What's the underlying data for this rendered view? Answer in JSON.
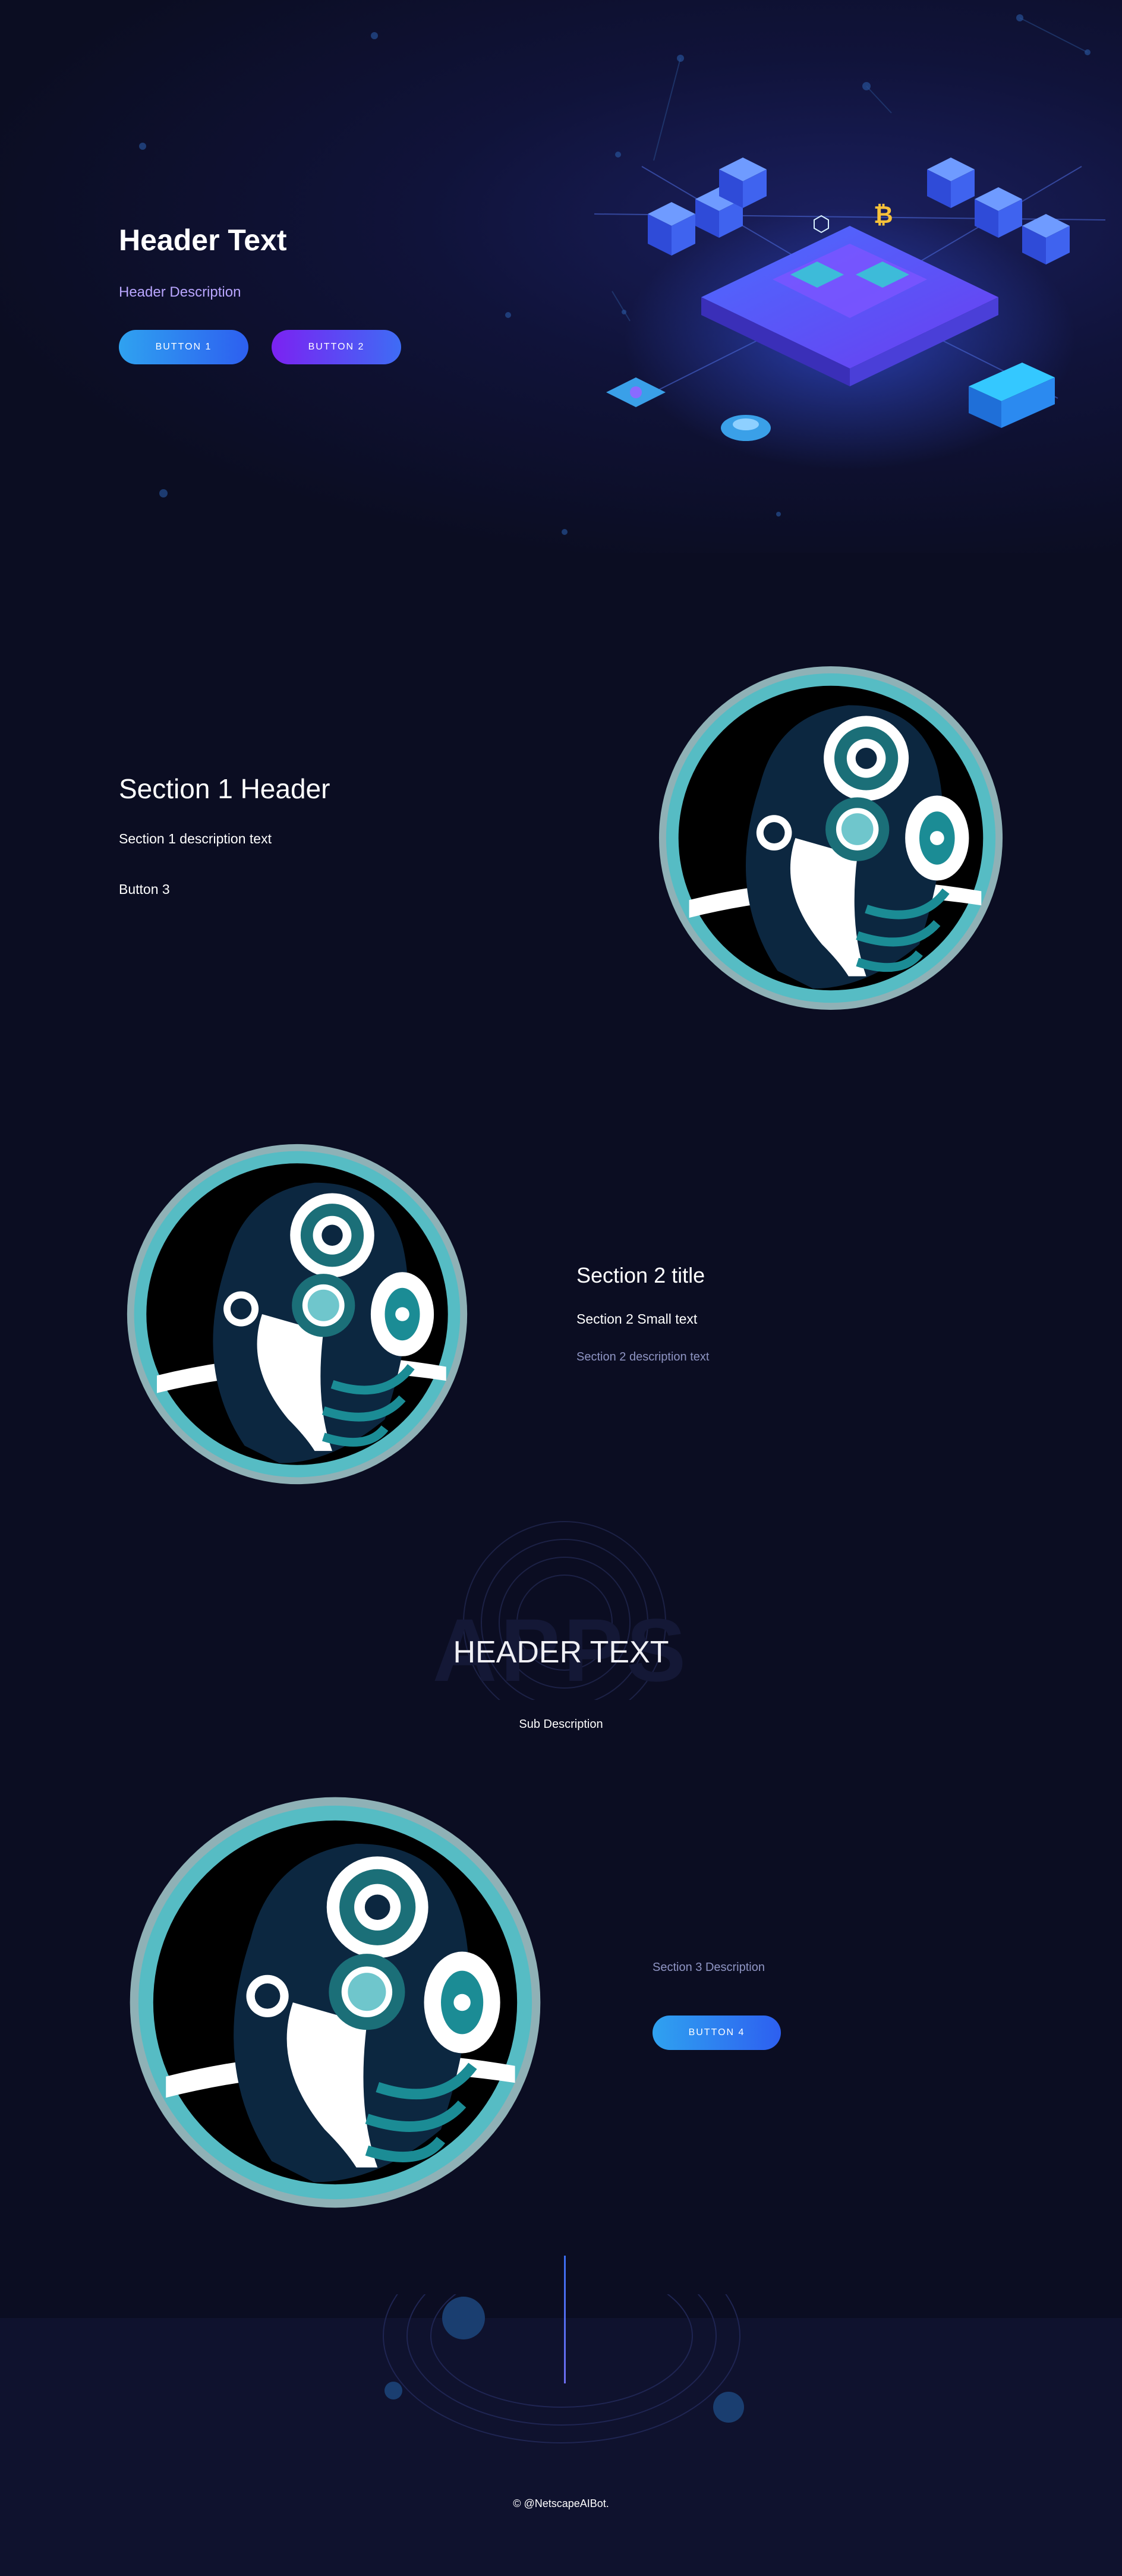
{
  "hero": {
    "title": "Header Text",
    "description": "Header Description",
    "button1": "BUTTON 1",
    "button2": "BUTTON 2"
  },
  "section1": {
    "header": "Section 1 Header",
    "description": "Section 1 description text",
    "button": "Button 3"
  },
  "section2": {
    "title": "Section 2 title",
    "small_text": "Section 2 Small text",
    "description": "Section 2 description text"
  },
  "middle": {
    "watermark": "APPS",
    "header": "HEADER TEXT",
    "sub_description": "Sub Description"
  },
  "section3": {
    "description": "Section 3 Description",
    "button": "BUTTON 4"
  },
  "footer": {
    "copyright": "© @NetscapeAIBot."
  },
  "icons": [
    "robot-head-avatar",
    "blockchain-platform-illustration",
    "bitcoin-icon"
  ],
  "colors": {
    "background": "#0b0d22",
    "accent_blue": "#2d7ff0",
    "accent_purple": "#7b22f2",
    "teal": "#1b8c95"
  }
}
